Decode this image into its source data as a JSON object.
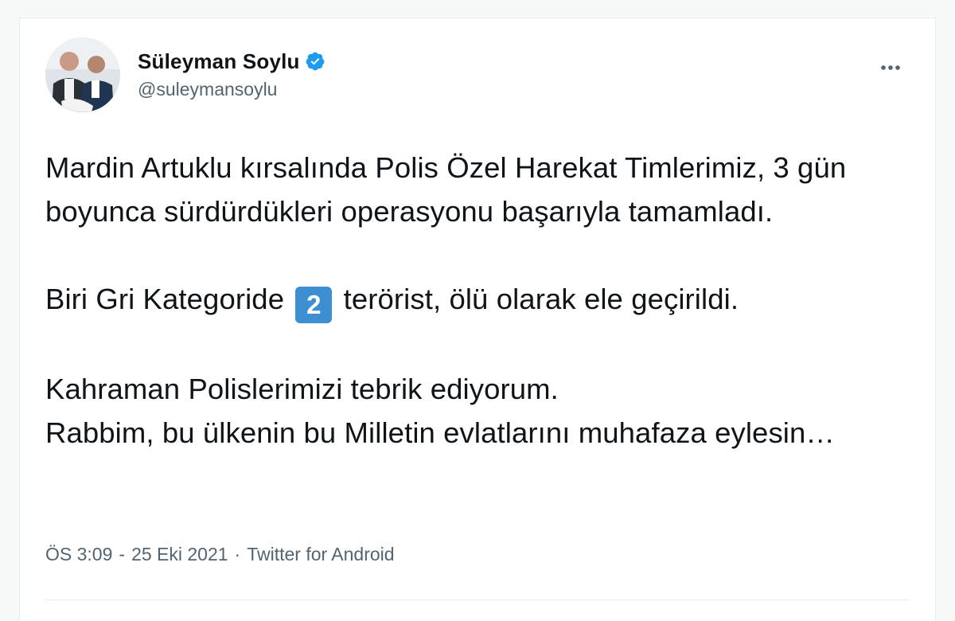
{
  "author": {
    "display_name": "Süleyman Soylu",
    "handle": "@suleymansoylu",
    "verified": true
  },
  "tweet": {
    "paragraph_1": "Mardin Artuklu kırsalında Polis Özel Harekat Timlerimiz, 3 gün boyunca sürdürdükleri operasyonu başarıyla tamamladı.",
    "paragraph_2_before": "Biri Gri Kategoride",
    "paragraph_2_keycap": "2",
    "paragraph_2_after": "terörist, ölü olarak ele geçirildi.",
    "paragraph_3_line_1": "Kahraman Polislerimizi tebrik ediyorum.",
    "paragraph_3_line_2": "Rabbim, bu ülkenin bu Milletin evlatlarını muhafaza eylesin…"
  },
  "meta": {
    "time": "ÖS 3:09",
    "date": "25 Eki 2021",
    "separator": "·",
    "source": "Twitter for Android"
  },
  "icons": {
    "verified": "verified-badge-icon",
    "more": "more-horizontal-icon"
  },
  "colors": {
    "verified_blue": "#1d9bf0",
    "keycap_blue": "#3d8fd1",
    "secondary_text": "#536471"
  }
}
